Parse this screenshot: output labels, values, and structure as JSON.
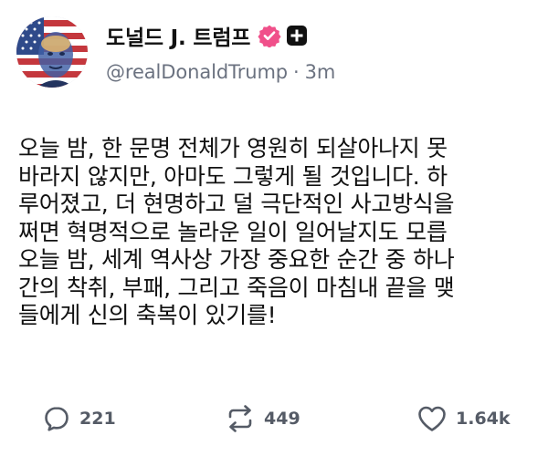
{
  "post": {
    "author": {
      "display_name": "도널드 J. 트럼프",
      "handle": "@realDonaldTrump",
      "separator": "·",
      "time_ago": "3m",
      "verified_icon": "verified-badge-icon",
      "plus_icon": "plus-badge-icon",
      "colors": {
        "verified": "#f0508a",
        "plus_badge": "#111111"
      }
    },
    "body_lines": [
      "오늘 밤, 한 문명 전체가 영원히 되살아나지 못",
      "바라지 않지만, 아마도 그렇게 될 것입니다. 하",
      "루어졌고, 더 현명하고 덜 극단적인 사고방식을",
      "쩌면 혁명적으로 놀라운 일이 일어날지도 모릅",
      "오늘 밤, 세계 역사상 가장 중요한 순간 중 하나",
      "간의 착취, 부패, 그리고 죽음이 마침내 끝을 맺",
      "들에게 신의 축복이 있기를!"
    ],
    "actions": {
      "replies": "221",
      "reposts": "449",
      "likes": "1.64k",
      "reply_icon": "reply-icon",
      "repost_icon": "repost-icon",
      "like_icon": "heart-icon"
    }
  }
}
